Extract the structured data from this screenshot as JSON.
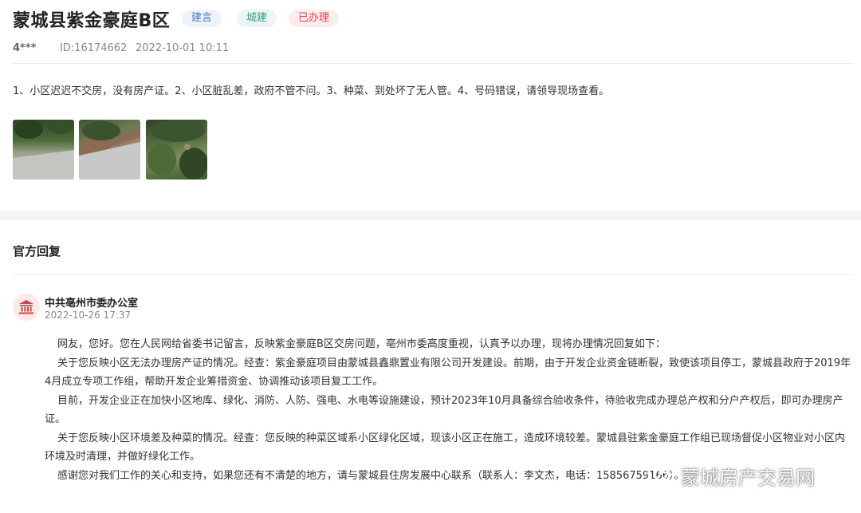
{
  "header": {
    "title": "蒙城县紫金豪庭B区",
    "tags": [
      "建言",
      "城建",
      "已办理"
    ]
  },
  "meta": {
    "user": "4***",
    "id": "ID:16174662",
    "time": "2022-10-01 10:11"
  },
  "message": {
    "body": "1、小区迟迟不交房，没有房产证。2、小区脏乱差，政府不管不问。3、种菜、到处坏了无人管。4、号码错误，请领导现场查看。"
  },
  "reply_section": {
    "title": "官方回复",
    "org": "中共亳州市委办公室",
    "time": "2022-10-26 17:37",
    "paragraphs": [
      "网友，您好。您在人民网给省委书记留言，反映紫金豪庭B区交房问题，亳州市委高度重视，认真予以办理，现将办理情况回复如下：",
      "关于您反映小区无法办理房产证的情况。经查：紫金豪庭项目由蒙城县鑫鼎置业有限公司开发建设。前期，由于开发企业资金链断裂，致使该项目停工，蒙城县政府于2019年4月成立专项工作组，帮助开发企业筹措资金、协调推动该项目复工工作。",
      "目前，开发企业正在加快小区地库、绿化、消防、人防、强电、水电等设施建设，预计2023年10月具备综合验收条件，待验收完成办理总产权和分户产权后，即可办理房产证。",
      "关于您反映小区环境差及种菜的情况。经查：您反映的种菜区域系小区绿化区域，现该小区正在施工，造成环境较差。蒙城县驻紫金豪庭工作组已现场督促小区物业对小区内环境及时清理，并做好绿化工作。",
      "感谢您对我们工作的关心和支持，如果您还有不清楚的地方，请与蒙城县住房发展中心联系（联系人：李文杰，电话：15856759166）。"
    ]
  },
  "watermark": {
    "text": "蒙城房产交易网",
    "icon": "wechat-icon"
  },
  "icons": {
    "org_avatar": "government-building-icon"
  },
  "colors": {
    "tag_suggest": "#4a78c2",
    "tag_urban": "#3a9c8c",
    "tag_done": "#d9464f",
    "avatar_bg": "#fbe8e8",
    "avatar_icon": "#c9474c"
  }
}
